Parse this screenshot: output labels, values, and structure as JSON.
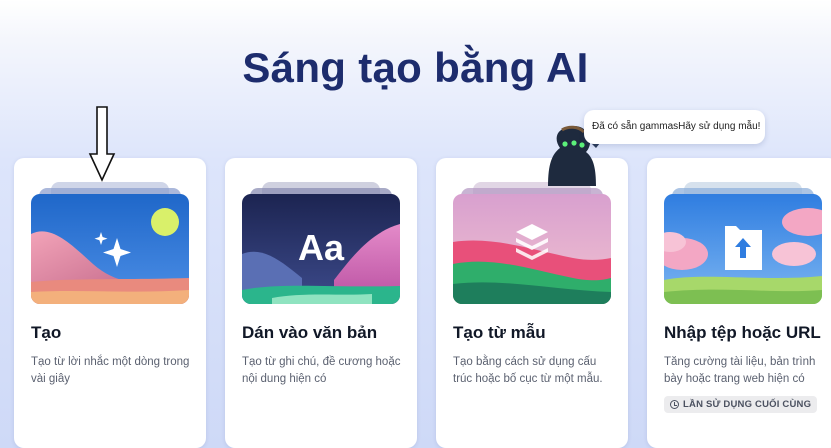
{
  "page": {
    "title": "Sáng tạo bằng AI"
  },
  "tooltip": {
    "text": "Đã có sẵn gammasHãy sử dụng mẫu!"
  },
  "cards": [
    {
      "title": "Tạo",
      "description": "Tạo từ lời nhắc một dòng trong vài giây",
      "icon": "sparkles-icon"
    },
    {
      "title": "Dán vào văn bản",
      "description": "Tạo từ ghi chú, đề cương hoặc nội dung hiện có",
      "icon": "text-aa-icon",
      "icon_text": "Aa"
    },
    {
      "title": "Tạo từ mẫu",
      "description": "Tạo bằng cách sử dụng cấu trúc hoặc bố cục từ một mẫu.",
      "icon": "layers-icon"
    },
    {
      "title": "Nhập tệp hoặc URL",
      "description": "Tăng cường tài liệu, bản trình bày hoặc trang web hiện có",
      "icon": "upload-file-icon",
      "badge": "LẦN SỬ DỤNG CUỐI CÙNG"
    }
  ],
  "colors": {
    "title": "#1d2c6d",
    "card_background": "#ffffff",
    "page_gradient_bottom": "#ced9f7"
  }
}
